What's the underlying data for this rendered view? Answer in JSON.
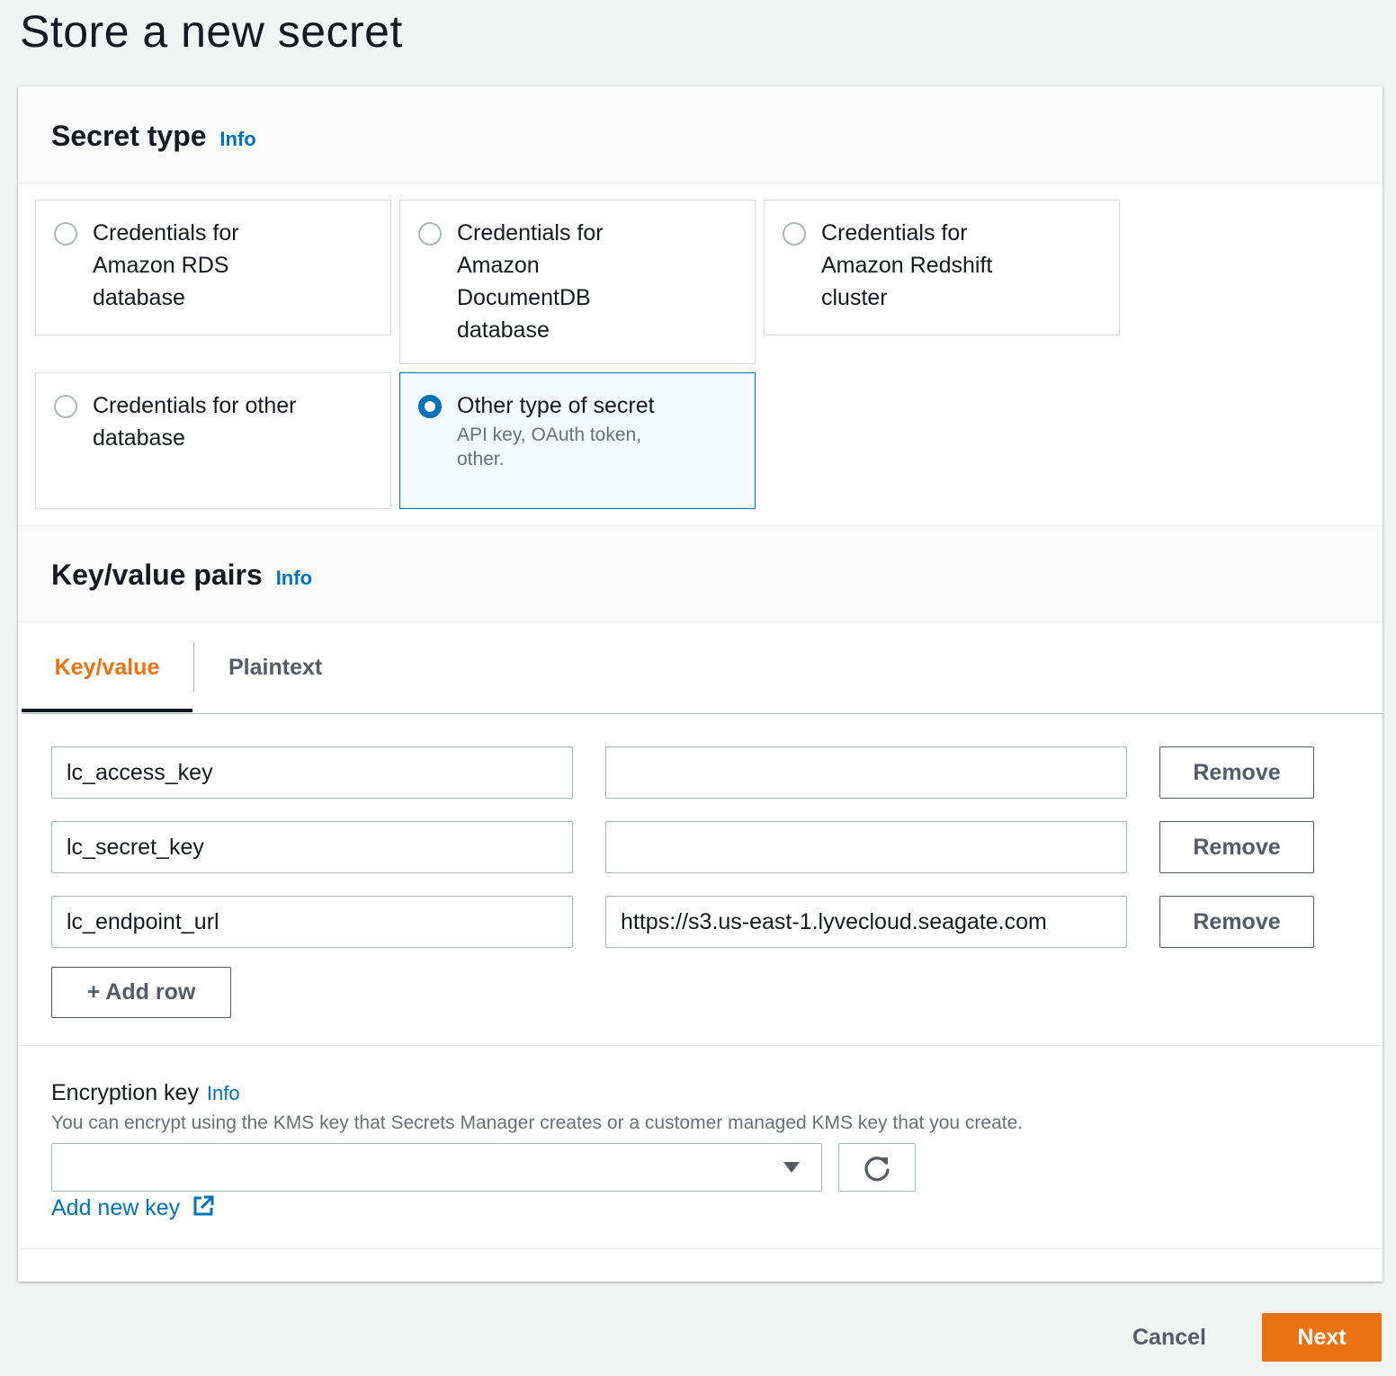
{
  "page": {
    "title": "Store a new secret"
  },
  "secret_type": {
    "heading": "Secret type",
    "info": "Info",
    "tiles": [
      {
        "label": "Credentials for Amazon RDS database",
        "description": "",
        "selected": false
      },
      {
        "label": "Credentials for Amazon DocumentDB database",
        "description": "",
        "selected": false
      },
      {
        "label": "Credentials for Amazon Redshift cluster",
        "description": "",
        "selected": false
      },
      {
        "label": "Credentials for other database",
        "description": "",
        "selected": false
      },
      {
        "label": "Other type of secret",
        "description": "API key, OAuth token, other.",
        "selected": true
      }
    ]
  },
  "kv_pairs": {
    "heading": "Key/value pairs",
    "info": "Info",
    "tabs": [
      {
        "label": "Key/value",
        "active": true
      },
      {
        "label": "Plaintext",
        "active": false
      }
    ],
    "rows": [
      {
        "key": "lc_access_key",
        "value": "",
        "remove_label": "Remove"
      },
      {
        "key": "lc_secret_key",
        "value": "",
        "remove_label": "Remove"
      },
      {
        "key": "lc_endpoint_url",
        "value": "https://s3.us-east-1.lyvecloud.seagate.com",
        "remove_label": "Remove"
      }
    ],
    "add_row_label": "+ Add row"
  },
  "encryption": {
    "label": "Encryption key",
    "info": "Info",
    "description": "You can encrypt using the KMS key that Secrets Manager creates or a customer managed KMS key that you create.",
    "selected_value": "",
    "add_new_key_label": "Add new key"
  },
  "footer": {
    "cancel_label": "Cancel",
    "next_label": "Next"
  },
  "colors": {
    "accent": "#ec7211",
    "link": "#0073bb",
    "selected_border": "#0073bb"
  },
  "icons": {
    "select_caret": "caret-down-icon",
    "refresh": "refresh-icon",
    "external_link": "external-link-icon"
  }
}
